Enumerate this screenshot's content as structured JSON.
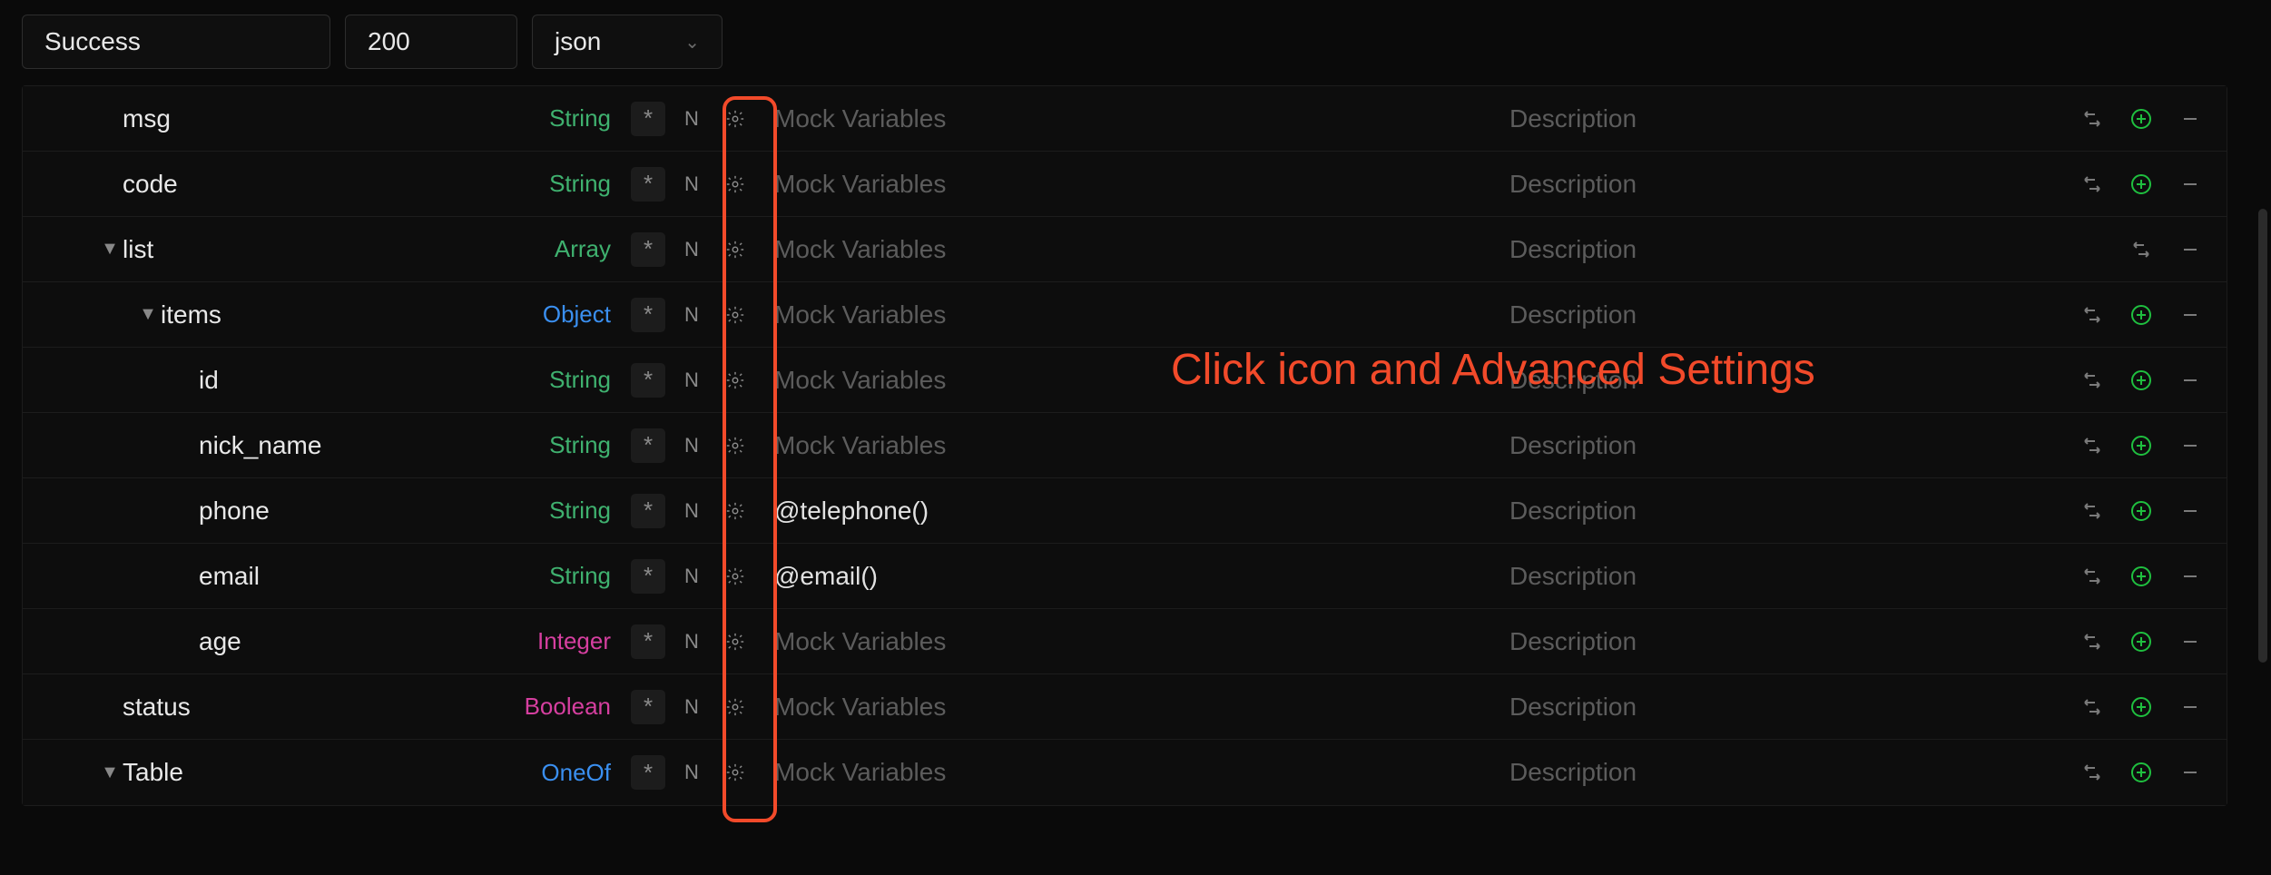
{
  "topbar": {
    "status_value": "Success",
    "code_value": "200",
    "format_value": "json"
  },
  "placeholders": {
    "mock": "Mock Variables",
    "desc": "Description"
  },
  "rows": [
    {
      "indent": 1,
      "caret": false,
      "name": "msg",
      "type": "String",
      "type_class": "t-string",
      "mock_value": "",
      "link": true,
      "add": true,
      "remove": true
    },
    {
      "indent": 1,
      "caret": false,
      "name": "code",
      "type": "String",
      "type_class": "t-string",
      "mock_value": "",
      "link": true,
      "add": true,
      "remove": true
    },
    {
      "indent": 1,
      "caret": true,
      "name": "list",
      "type": "Array",
      "type_class": "t-array",
      "mock_value": "",
      "link": true,
      "add": false,
      "remove": true
    },
    {
      "indent": 2,
      "caret": true,
      "name": "items",
      "type": "Object",
      "type_class": "t-object",
      "mock_value": "",
      "link": true,
      "add": true,
      "remove": true
    },
    {
      "indent": 3,
      "caret": false,
      "name": "id",
      "type": "String",
      "type_class": "t-string",
      "mock_value": "",
      "link": true,
      "add": true,
      "remove": true
    },
    {
      "indent": 3,
      "caret": false,
      "name": "nick_name",
      "type": "String",
      "type_class": "t-string",
      "mock_value": "",
      "link": true,
      "add": true,
      "remove": true
    },
    {
      "indent": 3,
      "caret": false,
      "name": "phone",
      "type": "String",
      "type_class": "t-string",
      "mock_value": "@telephone()",
      "link": true,
      "add": true,
      "remove": true
    },
    {
      "indent": 3,
      "caret": false,
      "name": "email",
      "type": "String",
      "type_class": "t-string",
      "mock_value": "@email()",
      "link": true,
      "add": true,
      "remove": true
    },
    {
      "indent": 3,
      "caret": false,
      "name": "age",
      "type": "Integer",
      "type_class": "t-integer",
      "mock_value": "",
      "link": true,
      "add": true,
      "remove": true
    },
    {
      "indent": 1,
      "caret": false,
      "name": "status",
      "type": "Boolean",
      "type_class": "t-boolean",
      "mock_value": "",
      "link": true,
      "add": true,
      "remove": true
    },
    {
      "indent": 1,
      "caret": true,
      "name": "Table",
      "type": "OneOf",
      "type_class": "t-oneof",
      "mock_value": "",
      "link": true,
      "add": true,
      "remove": true
    }
  ],
  "annotation": "Click icon and Advanced Settings"
}
